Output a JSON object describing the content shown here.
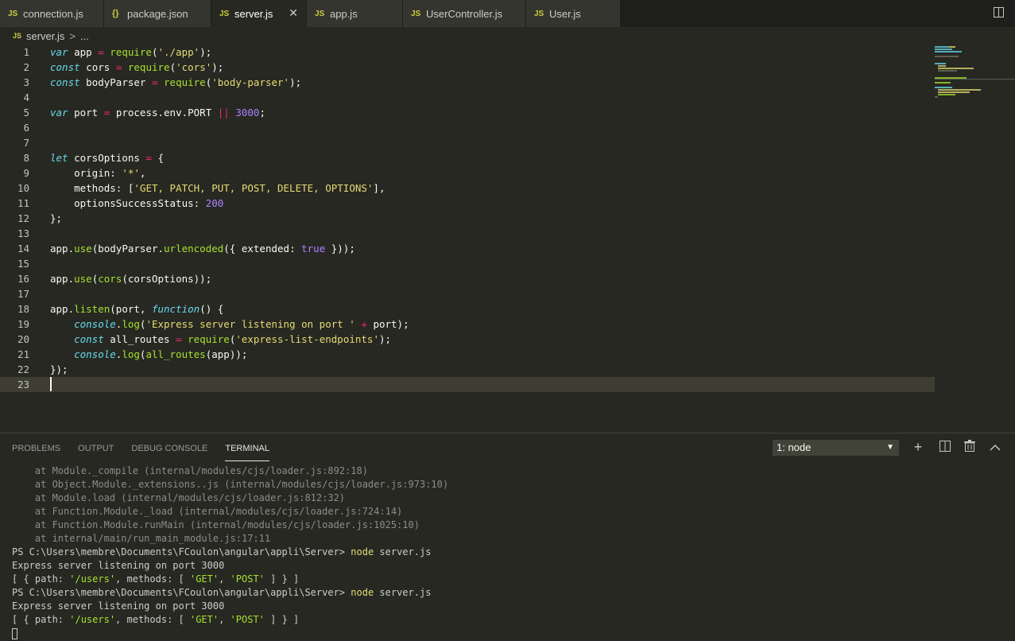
{
  "tabs": [
    {
      "icon": "JS",
      "label": "connection.js"
    },
    {
      "icon": "{}",
      "label": "package.json"
    },
    {
      "icon": "JS",
      "label": "server.js",
      "close": "✕"
    },
    {
      "icon": "JS",
      "label": "app.js"
    },
    {
      "icon": "JS",
      "label": "UserController.js"
    },
    {
      "icon": "JS",
      "label": "User.js"
    }
  ],
  "breadcrumb": {
    "icon": "JS",
    "file": "server.js",
    "sep": ">",
    "more": "..."
  },
  "editor": {
    "line_numbers": [
      "1",
      "2",
      "3",
      "4",
      "5",
      "6",
      "7",
      "8",
      "9",
      "10",
      "11",
      "12",
      "13",
      "14",
      "15",
      "16",
      "17",
      "18",
      "19",
      "20",
      "21",
      "22",
      "23"
    ],
    "current_line": 23,
    "tok": {
      "var": "var",
      "const": "const",
      "let": "let",
      "function": "function",
      "require": "require",
      "eq": "=",
      "or": "||",
      "app_id": "app",
      "cors_id": "cors",
      "bodyParser_id": "bodyParser",
      "port_id": "port",
      "corsOptions_id": "corsOptions",
      "all_routes_id": "all_routes",
      "s_app": "'./app'",
      "s_cors": "'cors'",
      "s_bodyparser": "'body-parser'",
      "n_3000": "3000",
      "n_200": "200",
      "b_true": "true",
      "process_env": "process.env.PORT",
      "origin_key": "origin:",
      "s_star": "'*'",
      "methods_key": "methods:",
      "s_methods": "'GET, PATCH, PUT, POST, DELETE, OPTIONS'",
      "oss_key": "optionsSuccessStatus:",
      "use": "use",
      "urlencoded": "urlencoded",
      "listen": "listen",
      "console": "console",
      "log": "log",
      "extended": "extended:",
      "all_routes_call": "all_routes",
      "s_express": "'Express server listening on port '",
      "plus": "+",
      "s_listend": "'express-list-endpoints'"
    }
  },
  "panel": {
    "tabs": [
      "PROBLEMS",
      "OUTPUT",
      "DEBUG CONSOLE",
      "TERMINAL"
    ],
    "active_tab": "TERMINAL",
    "terminal_select": "1: node",
    "icons": {
      "add": "+",
      "split": "split-terminal-icon",
      "trash": "trash-icon",
      "maximize": "chevron-up-icon"
    }
  },
  "terminal": {
    "stack": [
      "    at Module._compile (internal/modules/cjs/loader.js:892:18)",
      "    at Object.Module._extensions..js (internal/modules/cjs/loader.js:973:10)",
      "    at Module.load (internal/modules/cjs/loader.js:812:32)",
      "    at Function.Module._load (internal/modules/cjs/loader.js:724:14)",
      "    at Function.Module.runMain (internal/modules/cjs/loader.js:1025:10)",
      "    at internal/main/run_main_module.js:17:11"
    ],
    "prompt": "PS C:\\Users\\membre\\Documents\\FCoulon\\angular\\appli\\Server> ",
    "cmd": "node",
    "cmd_arg": " server.js",
    "listening": "Express server listening on port 3000",
    "routes_a": "[ { path: ",
    "routes_path": "'/users'",
    "routes_b": ", methods: [ ",
    "routes_get": "'GET'",
    "routes_c": ", ",
    "routes_post": "'POST'",
    "routes_d": " ] } ]"
  }
}
